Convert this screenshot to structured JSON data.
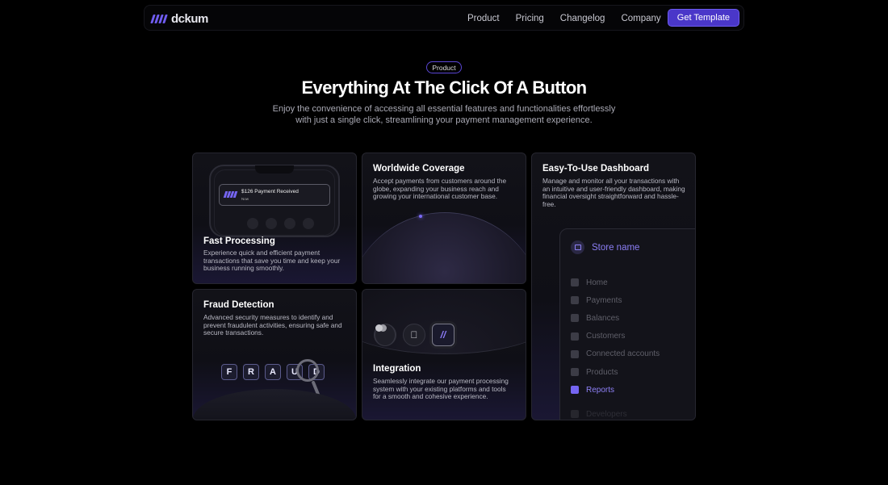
{
  "nav": {
    "logo_text": "dckum",
    "links": [
      "Product",
      "Pricing",
      "Changelog",
      "Company"
    ],
    "cta": "Get Template"
  },
  "hero": {
    "badge": "Product",
    "title": "Everything At The Click Of A Button",
    "subtitle": "Enjoy the convenience of accessing all essential features and functionalities effortlessly with just a single click, streamlining your payment management experience."
  },
  "cards": {
    "fast": {
      "title": "Fast Processing",
      "desc": "Experience quick and efficient payment transactions that save you time and keep your business running smoothly.",
      "notification": "$126 Payment Received",
      "notification_sub": "Now"
    },
    "worldwide": {
      "title": "Worldwide Coverage",
      "desc": "Accept payments from customers around the globe, expanding your business reach and growing your international customer base."
    },
    "dashboard": {
      "title": "Easy-To-Use Dashboard",
      "desc": "Manage and monitor all your transactions with an intuitive and user-friendly dashboard, making financial oversight straightforward and hassle-free.",
      "store_name": "Store name",
      "menu": [
        "Home",
        "Payments",
        "Balances",
        "Customers",
        "Connected accounts",
        "Products",
        "Reports",
        "Developers"
      ],
      "active_item": "Reports"
    },
    "fraud": {
      "title": "Fraud Detection",
      "desc": "Advanced security measures to identify and prevent fraudulent activities, ensuring safe and secure transactions.",
      "letters": [
        "F",
        "R",
        "A",
        "U",
        "D"
      ]
    },
    "integration": {
      "title": "Integration",
      "desc": "Seamlessly integrate our payment processing system with your existing platforms and tools for a smooth and cohesive experience.",
      "icons": [
        "mastercard-icon",
        "apple-icon",
        "brand-logo-icon"
      ]
    }
  },
  "colors": {
    "accent": "#4a37c9",
    "accent_light": "#8b7ef4",
    "background": "#000000"
  }
}
